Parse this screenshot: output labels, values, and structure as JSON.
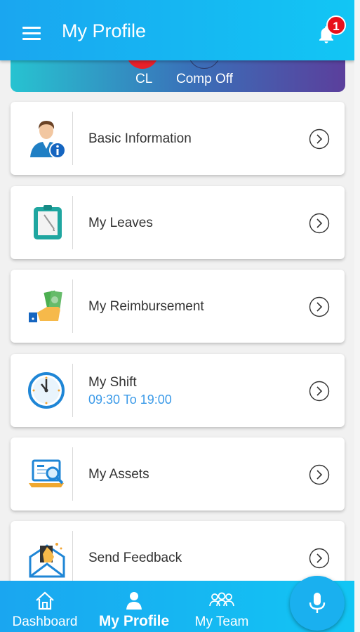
{
  "header": {
    "title": "My Profile",
    "notification_count": "1"
  },
  "leave_summary": [
    {
      "label": "CL",
      "color": "#e8202a"
    },
    {
      "label": "Comp Off",
      "color": "#2d3a6a"
    }
  ],
  "menu": [
    {
      "label": "Basic Information",
      "icon": "user-info-icon"
    },
    {
      "label": "My Leaves",
      "icon": "clipboard-icon"
    },
    {
      "label": "My Reimbursement",
      "icon": "money-hand-icon"
    },
    {
      "label": "My Shift",
      "sub": "09:30 To 19:00",
      "icon": "clock-icon"
    },
    {
      "label": "My Assets",
      "icon": "laptop-search-icon"
    },
    {
      "label": "Send Feedback",
      "icon": "feedback-envelope-icon"
    }
  ],
  "bottom_nav": [
    {
      "label": "Dashboard",
      "icon": "home-icon"
    },
    {
      "label": "My Profile",
      "icon": "person-icon",
      "active": true
    },
    {
      "label": "My Team",
      "icon": "team-icon"
    }
  ],
  "colors": {
    "header": "#1aa6f0",
    "accent_text": "#3b9ae8",
    "badge": "#e8101a"
  }
}
